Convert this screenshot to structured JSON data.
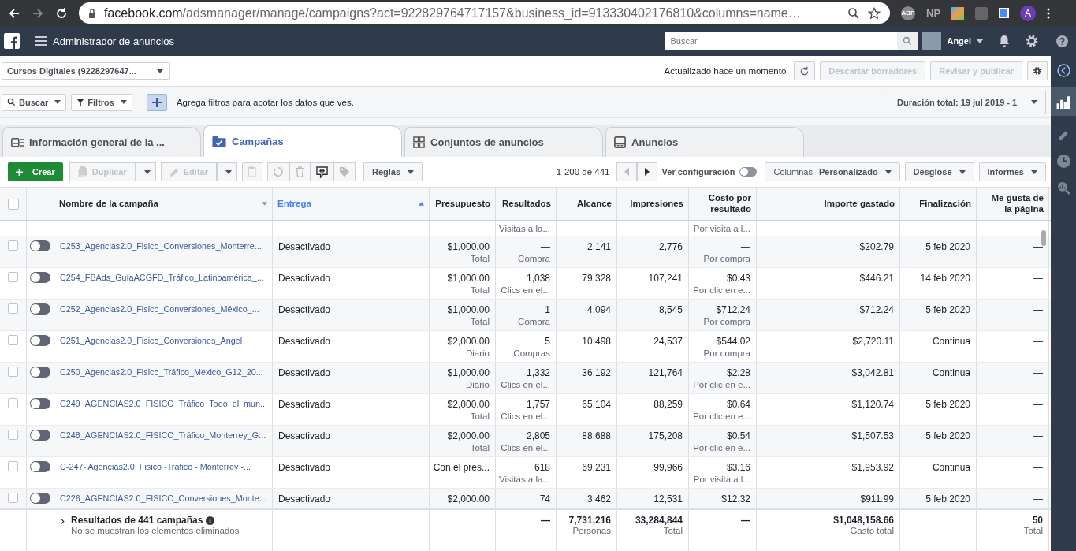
{
  "browser": {
    "url_host": "facebook.com",
    "url_path": "/adsmanager/manage/campaigns?act=922829764717157&business_id=913330402176810&columns=name…",
    "extensions": [
      "ABP",
      "NP"
    ],
    "profile": "A"
  },
  "header": {
    "title": "Administrador de anuncios",
    "search": {
      "placeholder": "Buscar"
    },
    "user": "Angel"
  },
  "account_bar": {
    "account": "Cursos Digitales (9228297647...",
    "status": "Actualizado hace un momento",
    "buttons": [
      {
        "label": "Descartar borradores",
        "disabled": true
      },
      {
        "label": "Revisar y publicar",
        "disabled": true
      }
    ]
  },
  "filter_bar": {
    "search_label": "Buscar",
    "filters_label": "Filtros",
    "hint": "Agrega filtros para acotar los datos que ves.",
    "date_range": "Duración total: 19 jul 2019 - 1"
  },
  "tabs": [
    {
      "label": "Información general de la ...",
      "kind": "overview",
      "selected": false
    },
    {
      "label": "Campañas",
      "kind": "campaigns",
      "selected": true
    },
    {
      "label": "Conjuntos de anuncios",
      "kind": "adsets",
      "selected": false
    },
    {
      "label": "Anuncios",
      "kind": "ads",
      "selected": false
    }
  ],
  "toolbar": {
    "create": "Crear",
    "duplicate": {
      "label": "Duplicar",
      "disabled": true
    },
    "edit": {
      "label": "Editar",
      "disabled": true
    },
    "rules": "Reglas",
    "pagination": "1-200 de 441",
    "settings_label": "Ver configuración",
    "settings_on": false,
    "columns": "Columnas: **Personalizado**",
    "breakdown": "Desglose",
    "reports": "Informes"
  },
  "table": {
    "select_all": false,
    "columns": [
      {
        "label": "Nombre de la campaña",
        "kind": "text",
        "sorted": false
      },
      {
        "label": "Entrega",
        "kind": "text",
        "sorted": true
      },
      {
        "label": "Presupuesto"
      },
      {
        "label": "Resultados"
      },
      {
        "label": "Alcance"
      },
      {
        "label": "Impresiones"
      },
      {
        "label": "Costo por resultado"
      },
      {
        "label": "Importe gastado"
      },
      {
        "label": "Finalización"
      },
      {
        "label": "Me gusta de la página"
      }
    ],
    "partial_row": {
      "results_type": "Visitas a la...",
      "cost_type": "Por visita a l..."
    },
    "rows": [
      {
        "name": "C253_Agencias2.0_Fisico_Conversiones_Monterre...",
        "delivery": "Desactivado",
        "on": false,
        "selected": false,
        "budget": "$1,000.00",
        "budget_type": "Total",
        "results": "—",
        "results_type": "Compra",
        "reach": "2,141",
        "impressions": "2,776",
        "cost": "—",
        "cost_type": "Por compra",
        "spent": "$202.79",
        "end": "5 feb 2020",
        "likes": "—"
      },
      {
        "name": "C254_FBAds_GuíaACGFD_Tráfico_Latinoamérica_...",
        "delivery": "Desactivado",
        "on": false,
        "selected": false,
        "budget": "$1,000.00",
        "budget_type": "Total",
        "results": "1,038",
        "results_type": "Clics en el...",
        "reach": "79,328",
        "impressions": "107,241",
        "cost": "$0.43",
        "cost_type": "Por clic en e...",
        "spent": "$446.21",
        "end": "14 feb 2020",
        "likes": "—"
      },
      {
        "name": "C252_Agencias2.0_Fisico_Conversiones_México_...",
        "delivery": "Desactivado",
        "on": false,
        "selected": false,
        "budget": "$1,000.00",
        "budget_type": "Total",
        "results": "1",
        "results_type": "Compra",
        "reach": "4,094",
        "impressions": "8,545",
        "cost": "$712.24",
        "cost_type": "Por compra",
        "spent": "$712.24",
        "end": "5 feb 2020",
        "likes": "—"
      },
      {
        "name": "C251_Agencias2.0_Fisico_Conversiones_Angel",
        "delivery": "Desactivado",
        "on": false,
        "selected": false,
        "budget": "$2,000.00",
        "budget_type": "Diario",
        "results": "5",
        "results_type": "Compras",
        "reach": "10,498",
        "impressions": "24,537",
        "cost": "$544.02",
        "cost_type": "Por compra",
        "spent": "$2,720.11",
        "end": "Continua",
        "likes": "—"
      },
      {
        "name": "C250_Agencias2.0_Fisico_Tráfico_Mexico_G12_20...",
        "delivery": "Desactivado",
        "on": false,
        "selected": false,
        "budget": "$1,000.00",
        "budget_type": "Diario",
        "results": "1,332",
        "results_type": "Clics en el...",
        "reach": "36,192",
        "impressions": "121,764",
        "cost": "$2.28",
        "cost_type": "Por clic en e...",
        "spent": "$3,042.81",
        "end": "Continua",
        "likes": "—"
      },
      {
        "name": "C249_AGENCIAS2.0_FISICO_Tráfico_Todo_el_mun...",
        "delivery": "Desactivado",
        "on": false,
        "selected": false,
        "budget": "$2,000.00",
        "budget_type": "Total",
        "results": "1,757",
        "results_type": "Clics en el...",
        "reach": "65,104",
        "impressions": "88,259",
        "cost": "$0.64",
        "cost_type": "Por clic en e...",
        "spent": "$1,120.74",
        "end": "5 feb 2020",
        "likes": "—"
      },
      {
        "name": "C248_AGENCIAS2.0_FISICO_Tráfico_Monterrey_G...",
        "delivery": "Desactivado",
        "on": false,
        "selected": false,
        "budget": "$2,000.00",
        "budget_type": "Total",
        "results": "2,805",
        "results_type": "Clics en el...",
        "reach": "88,688",
        "impressions": "175,208",
        "cost": "$0.54",
        "cost_type": "Por clic en e...",
        "spent": "$1,507.53",
        "end": "5 feb 2020",
        "likes": "—"
      },
      {
        "name": "C-247- Agencias2.0_Fisico -Tráfico - Monterrey -...",
        "delivery": "Desactivado",
        "on": false,
        "selected": false,
        "budget": "Con el pres...",
        "results": "618",
        "results_type": "Visitas a la...",
        "reach": "69,231",
        "impressions": "99,966",
        "cost": "$3.16",
        "cost_type": "Por visita a l...",
        "spent": "$1,953.92",
        "end": "Continua",
        "likes": "—"
      },
      {
        "name": "C226_AGENCIAS2.0_FISICO_Conversiones_Monte...",
        "delivery": "Desactivado",
        "on": false,
        "selected": false,
        "budget": "$2,000.00",
        "results": "74",
        "reach": "3,462",
        "impressions": "12,531",
        "cost": "$12.32",
        "spent": "$911.99",
        "end": "5 feb 2020",
        "likes": "—"
      }
    ],
    "summary": {
      "title": "Resultados de 441 campañas",
      "note": "No se muestran los elementos eliminados",
      "results": "—",
      "reach": "7,731,216",
      "reach_type": "Personas",
      "impressions": "33,284,844",
      "impressions_type": "Total",
      "cost": "—",
      "spent": "$1,048,158.66",
      "spent_type": "Gasto total",
      "likes": "50",
      "likes_type": "Total"
    }
  }
}
